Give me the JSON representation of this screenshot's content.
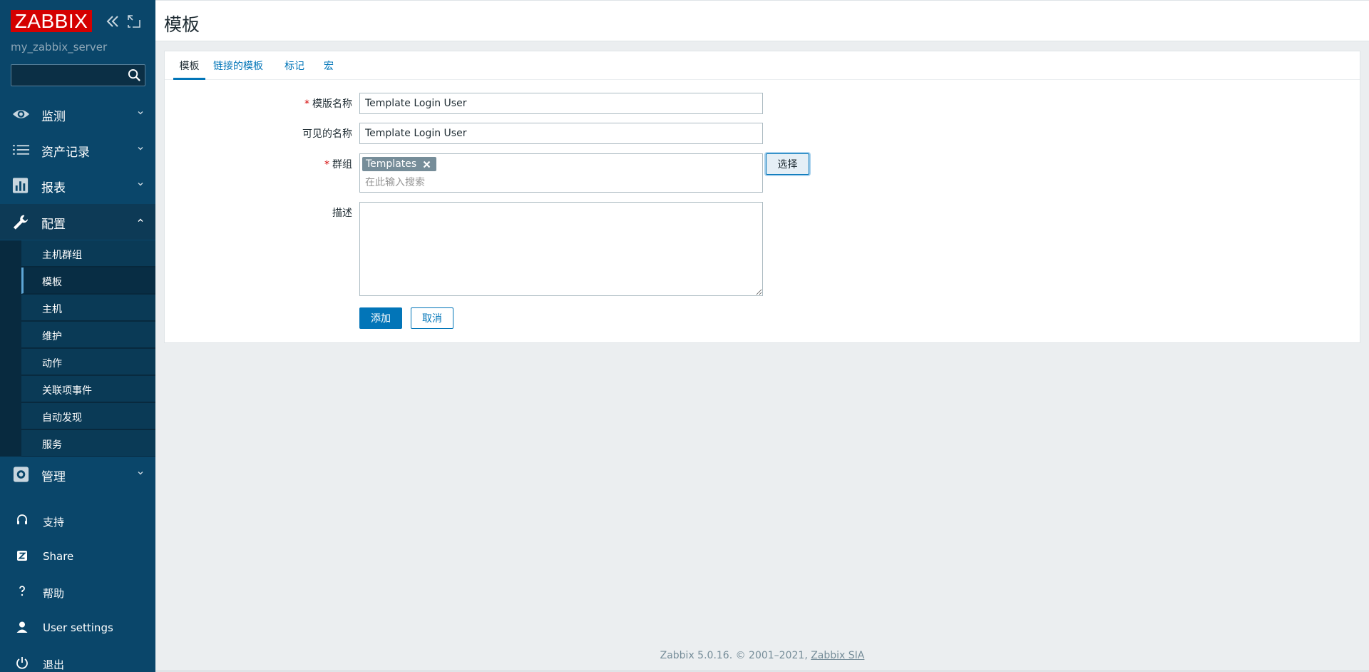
{
  "brand": {
    "logo_text": "ZABBIX",
    "server_name": "my_zabbix_server"
  },
  "search": {
    "value": "",
    "placeholder": ""
  },
  "menu": {
    "items": [
      {
        "label": "监测",
        "icon": "eye-icon"
      },
      {
        "label": "资产记录",
        "icon": "list-icon"
      },
      {
        "label": "报表",
        "icon": "bar-chart-icon"
      },
      {
        "label": "配置",
        "icon": "wrench-icon"
      },
      {
        "label": "管理",
        "icon": "gear-icon"
      }
    ],
    "config_sub": [
      "主机群组",
      "模板",
      "主机",
      "维护",
      "动作",
      "关联项事件",
      "自动发现",
      "服务"
    ],
    "bottom": [
      {
        "label": "支持",
        "icon": "headset-icon"
      },
      {
        "label": "Share",
        "icon": "share-z-icon"
      },
      {
        "label": "帮助",
        "icon": "help-icon"
      },
      {
        "label": "User settings",
        "icon": "user-icon"
      },
      {
        "label": "退出",
        "icon": "power-icon"
      }
    ]
  },
  "header": {
    "title": "模板"
  },
  "tabs": [
    "模板",
    "链接的模板",
    "标记",
    "宏"
  ],
  "form": {
    "template_name_label": "模版名称",
    "template_name_value": "Template Login User",
    "visible_name_label": "可见的名称",
    "visible_name_value": "Template Login User",
    "groups_label": "群组",
    "groups_chip": "Templates",
    "groups_placeholder": "在此输入搜索",
    "select_button": "选择",
    "description_label": "描述",
    "add_button": "添加",
    "cancel_button": "取消"
  },
  "footer": {
    "text": "Zabbix 5.0.16. © 2001–2021,",
    "link": "Zabbix SIA"
  },
  "colors": {
    "sidebar": "#0a466a",
    "accent": "#0275b8",
    "logo": "#d40000"
  }
}
